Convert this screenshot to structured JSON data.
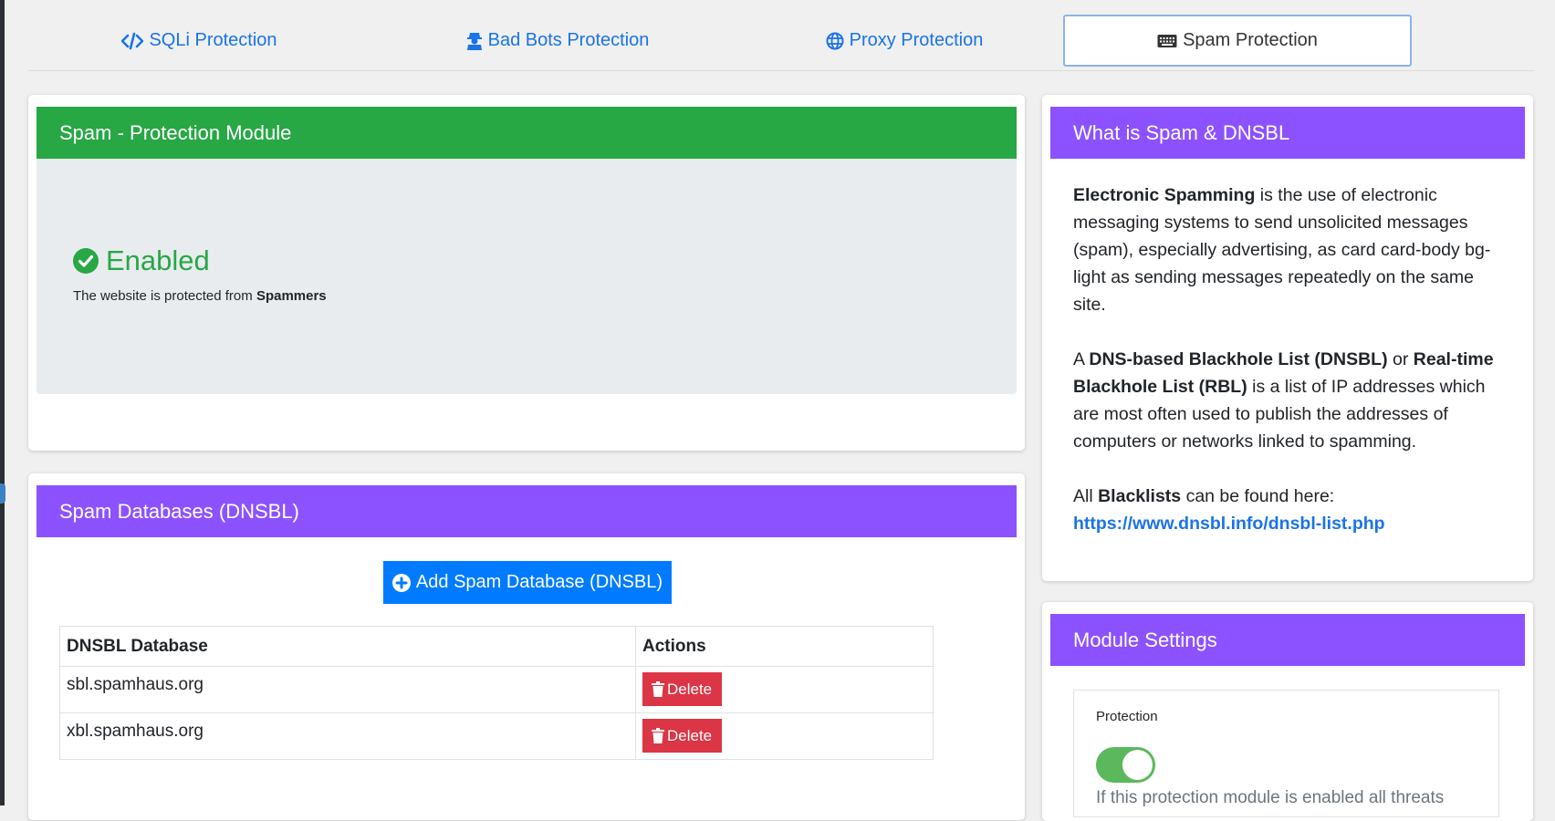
{
  "tabs": [
    {
      "label": "SQLi Protection",
      "icon": "code-icon"
    },
    {
      "label": "Bad Bots Protection",
      "icon": "user-secret-icon"
    },
    {
      "label": "Proxy Protection",
      "icon": "globe-icon"
    },
    {
      "label": "Spam Protection",
      "icon": "keyboard-icon",
      "active": true
    }
  ],
  "module": {
    "title": "Spam - Protection Module",
    "status": "Enabled",
    "status_icon": "check-circle-icon",
    "desc_prefix": "The website is protected from",
    "desc_bold": "Spammers"
  },
  "databases": {
    "title": "Spam Databases (DNSBL)",
    "add_button": "Add Spam Database (DNSBL)",
    "columns": [
      "DNSBL Database",
      "Actions"
    ],
    "rows": [
      {
        "name": "sbl.spamhaus.org",
        "action": "Delete"
      },
      {
        "name": "xbl.spamhaus.org",
        "action": "Delete"
      }
    ]
  },
  "info": {
    "title": "What is Spam & DNSBL",
    "p1_bold": "Electronic Spamming",
    "p1_text": " is the use of electronic messaging systems to send unsolicited messages (spam), especially advertising, as card card-body bg-light as sending messages repeatedly on the same site.",
    "p2_a": "A ",
    "p2_bold1": "DNS-based Blackhole List (DNSBL)",
    "p2_b": " or ",
    "p2_bold2": "Real-time Blackhole List (RBL)",
    "p2_c": " is a list of IP addresses which are most often used to publish the addresses of computers or networks linked to spamming.",
    "p3_a": "All ",
    "p3_bold": "Blacklists",
    "p3_b": " can be found here:",
    "link": "https://www.dnsbl.info/dnsbl-list.php"
  },
  "settings": {
    "title": "Module Settings",
    "protection_label": "Protection",
    "protection_on": true,
    "help": "If this protection module is enabled all threats"
  },
  "colors": {
    "green": "#28a745",
    "purple": "#8c52ff",
    "blue": "#007bff",
    "red": "#dc3545",
    "link": "#1a73e8"
  }
}
